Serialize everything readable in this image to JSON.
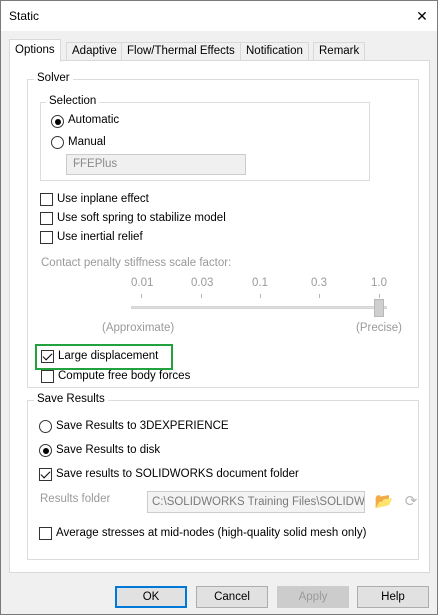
{
  "window": {
    "title": "Static",
    "close_glyph": "✕"
  },
  "tabs": [
    {
      "label": "Options",
      "active": true
    },
    {
      "label": "Adaptive",
      "active": false
    },
    {
      "label": "Flow/Thermal Effects",
      "active": false
    },
    {
      "label": "Notification",
      "active": false
    },
    {
      "label": "Remark",
      "active": false
    }
  ],
  "solver": {
    "group_label": "Solver",
    "selection": {
      "group_label": "Selection",
      "automatic_label": "Automatic",
      "automatic_selected": true,
      "manual_label": "Manual",
      "manual_selected": false,
      "solver_combo_value": "FFEPlus"
    },
    "options": [
      {
        "label": "Use inplane effect",
        "checked": false
      },
      {
        "label": "Use soft spring to stabilize model",
        "checked": false
      },
      {
        "label": "Use inertial relief",
        "checked": false
      }
    ],
    "contact_penalty": {
      "label": "Contact penalty stiffness scale factor:",
      "ticks": [
        "0.01",
        "0.03",
        "0.1",
        "0.3",
        "1.0"
      ],
      "min_label": "(Approximate)",
      "max_label": "(Precise)",
      "value": "1.0"
    },
    "large_displacement": {
      "label": "Large displacement",
      "checked": true
    },
    "compute_free_body": {
      "label": "Compute free body forces",
      "checked": false
    }
  },
  "save_results": {
    "group_label": "Save Results",
    "to_3dexperience": {
      "label": "Save Results to 3DEXPERIENCE",
      "selected": false
    },
    "to_disk": {
      "label": "Save Results to disk",
      "selected": true
    },
    "to_document_folder": {
      "label": "Save results to SOLIDWORKS document folder",
      "checked": true
    },
    "results_folder_label": "Results folder",
    "results_folder_value": "C:\\SOLIDWORKS Training Files\\SOLIDWO"
  },
  "average_stresses": {
    "label": "Average stresses at mid-nodes (high-quality solid mesh only)",
    "checked": false
  },
  "buttons": {
    "ok": "OK",
    "cancel": "Cancel",
    "apply": "Apply",
    "help": "Help"
  },
  "colors": {
    "highlight_border": "#22a23d",
    "default_button_border": "#0078d7"
  }
}
